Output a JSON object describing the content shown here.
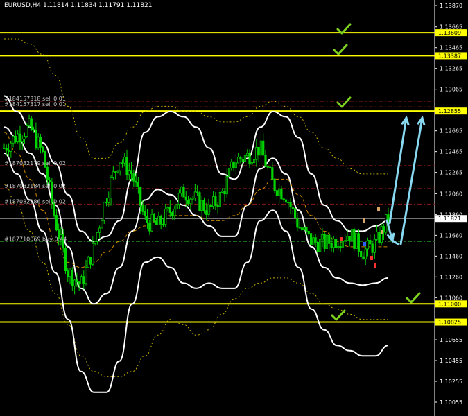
{
  "chart_data": {
    "type": "candlestick",
    "title": "EURUSD,H4  1.11814 1.11834 1.11791 1.11821",
    "symbol": "EURUSD",
    "timeframe": "H4",
    "ohlc_last": {
      "open": 1.11814,
      "high": 1.11834,
      "low": 1.11791,
      "close": 1.11821
    },
    "ylim": [
      1.0995,
      1.1391
    ],
    "y_ticks": [
      "1.13870",
      "1.13665",
      "1.13465",
      "1.13265",
      "1.13065",
      "1.12665",
      "1.12465",
      "1.12265",
      "1.12060",
      "1.11860",
      "1.11660",
      "1.11460",
      "1.11260",
      "1.11060",
      "1.10655",
      "1.10455",
      "1.10255",
      "1.10055"
    ],
    "current_price": {
      "value": 1.11821,
      "label": "1.11821"
    },
    "horizontal_levels": [
      {
        "value": 1.13609,
        "label": "1.13609",
        "color": "#ffff00",
        "check": true
      },
      {
        "value": 1.13387,
        "label": "1.13387",
        "color": "#ffff00",
        "check": true
      },
      {
        "value": 1.12855,
        "label": "1.12855",
        "color": "#ffff00",
        "check": true
      },
      {
        "value": 1.11,
        "label": "1.11000",
        "color": "#ffff00",
        "check": true
      },
      {
        "value": 1.10825,
        "label": "1.10825",
        "color": "#ffff00",
        "check": true
      }
    ],
    "orders": [
      {
        "label": "#184157318 sell 0.01",
        "value": 1.1295,
        "color": "#8b1a1a"
      },
      {
        "label": "#184157317 sell 0.01",
        "value": 1.12895,
        "color": "#8b1a1a"
      },
      {
        "label": "#187082179 sell 0.02",
        "value": 1.1233,
        "color": "#8b1a1a"
      },
      {
        "label": "#187082184 sell 0.02",
        "value": 1.1211,
        "color": "#8b1a1a"
      },
      {
        "label": "#187082186 sell 0.02",
        "value": 1.1196,
        "color": "#8b1a1a"
      },
      {
        "label": "#187710069 buy 0.44",
        "value": 1.116,
        "color": "#1e7a1e"
      }
    ],
    "bollinger_upper": [
      1.13,
      1.1285,
      1.127,
      1.1255,
      1.1235,
      1.1205,
      1.117,
      1.116,
      1.1165,
      1.118,
      1.122,
      1.1265,
      1.128,
      1.1285,
      1.128,
      1.127,
      1.125,
      1.1225,
      1.122,
      1.124,
      1.127,
      1.1285,
      1.128,
      1.126,
      1.1225,
      1.1195,
      1.118,
      1.117,
      1.117,
      1.1175,
      1.118
    ],
    "bollinger_middle": [
      1.127,
      1.126,
      1.1245,
      1.1225,
      1.1195,
      1.1155,
      1.1115,
      1.11,
      1.111,
      1.1135,
      1.117,
      1.12,
      1.121,
      1.1205,
      1.1195,
      1.1185,
      1.1175,
      1.1165,
      1.1165,
      1.1195,
      1.123,
      1.124,
      1.1225,
      1.119,
      1.1155,
      1.1135,
      1.1125,
      1.112,
      1.1118,
      1.112,
      1.1125
    ],
    "bollinger_lower": [
      1.1245,
      1.1225,
      1.12,
      1.117,
      1.113,
      1.1085,
      1.1035,
      1.1015,
      1.1015,
      1.1045,
      1.11,
      1.114,
      1.1145,
      1.1135,
      1.112,
      1.1115,
      1.112,
      1.1115,
      1.1115,
      1.114,
      1.118,
      1.119,
      1.117,
      1.1135,
      1.1095,
      1.1075,
      1.106,
      1.1055,
      1.105,
      1.105,
      1.106
    ],
    "envelope_upper": [
      1.1355,
      1.1355,
      1.135,
      1.134,
      1.132,
      1.129,
      1.126,
      1.124,
      1.124,
      1.1255,
      1.127,
      1.1285,
      1.129,
      1.129,
      1.1285,
      1.1285,
      1.128,
      1.1275,
      1.1275,
      1.128,
      1.129,
      1.1295,
      1.129,
      1.128,
      1.1265,
      1.125,
      1.124,
      1.123,
      1.1225,
      1.1225,
      1.1225
    ],
    "envelope_lower": [
      1.1215,
      1.1195,
      1.117,
      1.114,
      1.111,
      1.108,
      1.105,
      1.1035,
      1.103,
      1.103,
      1.1035,
      1.105,
      1.107,
      1.1085,
      1.108,
      1.107,
      1.1075,
      1.109,
      1.1105,
      1.1115,
      1.112,
      1.1125,
      1.1125,
      1.112,
      1.111,
      1.11,
      1.1095,
      1.109,
      1.1085,
      1.1085,
      1.1085
    ],
    "ma_line": [
      1.1265,
      1.1245,
      1.122,
      1.119,
      1.116,
      1.114,
      1.1135,
      1.114,
      1.115,
      1.116,
      1.117,
      1.1175,
      1.118,
      1.1185,
      1.1185,
      1.1185,
      1.118,
      1.118,
      1.1185,
      1.1195,
      1.121,
      1.122,
      1.122,
      1.1205,
      1.1185,
      1.117,
      1.116,
      1.1155,
      1.1155,
      1.1155,
      1.1155
    ],
    "close_path": [
      1.125,
      1.1262,
      1.127,
      1.1245,
      1.118,
      1.113,
      1.1118,
      1.1155,
      1.1205,
      1.124,
      1.1225,
      1.118,
      1.1175,
      1.119,
      1.1208,
      1.12,
      1.119,
      1.1205,
      1.1238,
      1.1242,
      1.125,
      1.1215,
      1.1205,
      1.1175,
      1.116,
      1.1158,
      1.1162,
      1.1168,
      1.115,
      1.1158,
      1.1182
    ],
    "arrows": [
      "down-up",
      "up",
      "up"
    ],
    "check_marks": 6
  }
}
